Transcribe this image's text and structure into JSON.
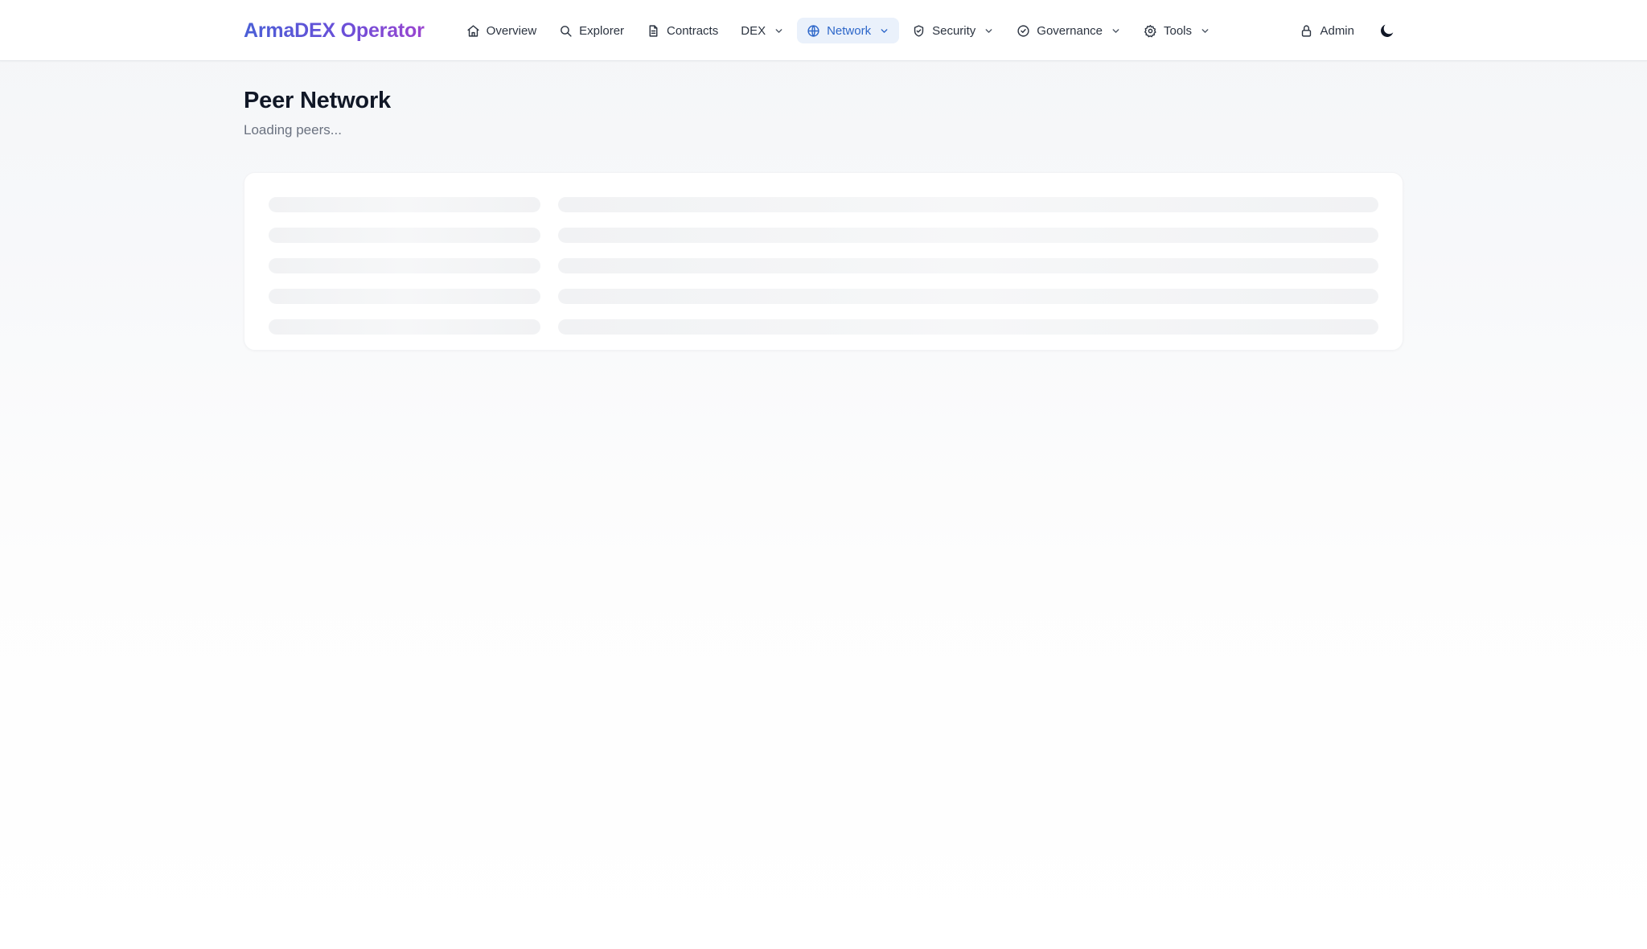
{
  "header": {
    "brand": "ArmaDEX Operator",
    "nav": [
      {
        "label": "Overview",
        "icon": "home-icon",
        "dropdown": false,
        "active": false
      },
      {
        "label": "Explorer",
        "icon": "search-icon",
        "dropdown": false,
        "active": false
      },
      {
        "label": "Contracts",
        "icon": "document-icon",
        "dropdown": false,
        "active": false
      },
      {
        "label": "DEX",
        "icon": "",
        "dropdown": true,
        "active": false
      },
      {
        "label": "Network",
        "icon": "globe-icon",
        "dropdown": true,
        "active": true
      },
      {
        "label": "Security",
        "icon": "shield-icon",
        "dropdown": true,
        "active": false
      },
      {
        "label": "Governance",
        "icon": "check-circle-icon",
        "dropdown": true,
        "active": false
      },
      {
        "label": "Tools",
        "icon": "gear-icon",
        "dropdown": true,
        "active": false
      }
    ],
    "admin_label": "Admin",
    "admin_icon": "lock-icon",
    "theme_icon": "moon-icon"
  },
  "page": {
    "title": "Peer Network",
    "subtitle": "Loading peers..."
  },
  "skeleton": {
    "rows": 5,
    "state": "loading"
  },
  "colors": {
    "brand_gradient_start": "#4a5fd6",
    "brand_gradient_end": "#9b45d0",
    "active_nav_bg": "#eaf1fb",
    "active_nav_text": "#2c66c9"
  }
}
